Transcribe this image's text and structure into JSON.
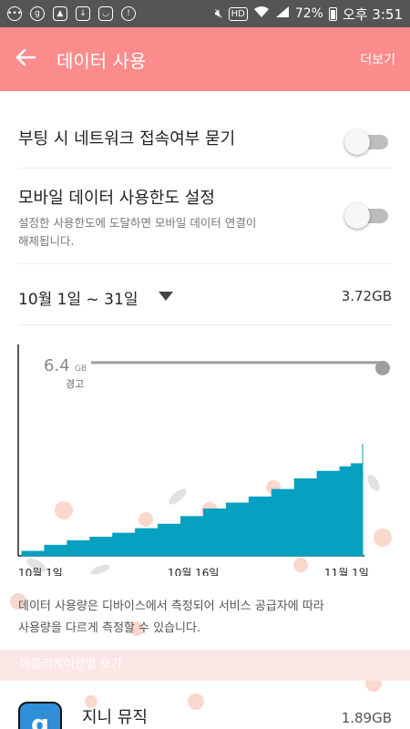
{
  "status_bar": {
    "battery": "72%",
    "time": "오후 3:51",
    "hd": "HD",
    "icons_left": [
      "chat-icon",
      "g-app-icon",
      "image-icon",
      "download-icon",
      "badge-icon",
      "alarm-icon"
    ],
    "icons_right": [
      "mute-icon",
      "hd-icon",
      "wifi-icon",
      "signal-icon",
      "battery-icon"
    ]
  },
  "app_bar": {
    "title": "데이터 사용",
    "more_label": "더보기",
    "back_icon": "back-arrow-icon",
    "color": "#fc8c8c"
  },
  "settings": {
    "roaming_ask": {
      "label": "부팅 시 네트워크 접속여부 묻기",
      "enabled": false
    },
    "mobile_limit": {
      "label": "모바일 데이터 사용한도 설정",
      "desc_line1": "설정한 사용한도에 도달하면 모바일 데이터 연결이",
      "desc_line2": "해제됩니다.",
      "enabled": false
    }
  },
  "period": {
    "label": "10월 1일 ~ 31일",
    "total": "3.72GB"
  },
  "chart_data": {
    "type": "area",
    "x_tick_labels": [
      "10월 1일",
      "10월 16일",
      "11월 1일"
    ],
    "warning": {
      "value_label": "6.4",
      "unit": "GB",
      "label": "경고",
      "value": 6.4
    },
    "x": [
      1,
      3,
      5,
      7,
      9,
      11,
      13,
      15,
      17,
      19,
      21,
      23,
      25,
      27,
      29,
      30,
      31
    ],
    "values": [
      0.15,
      0.35,
      0.5,
      0.62,
      0.75,
      0.9,
      1.05,
      1.3,
      1.55,
      1.75,
      1.95,
      2.2,
      2.55,
      2.8,
      2.95,
      3.05,
      3.72
    ],
    "ylim": [
      0,
      7.0
    ],
    "fill_color": "#06a0c0",
    "warning_color": "#9e9e9e"
  },
  "note": {
    "line1": "데이터 사용량은 디바이스에서 측정되어 서비스 공급자에 따라",
    "line2": "사용량을 다르게 측정할 수 있습니다."
  },
  "section_header": "애플리케이션별 보기",
  "apps": [
    {
      "name": "지니 뮤직",
      "usage": "1.89GB",
      "icon": "genie-music-icon",
      "icon_letter": "g"
    }
  ]
}
